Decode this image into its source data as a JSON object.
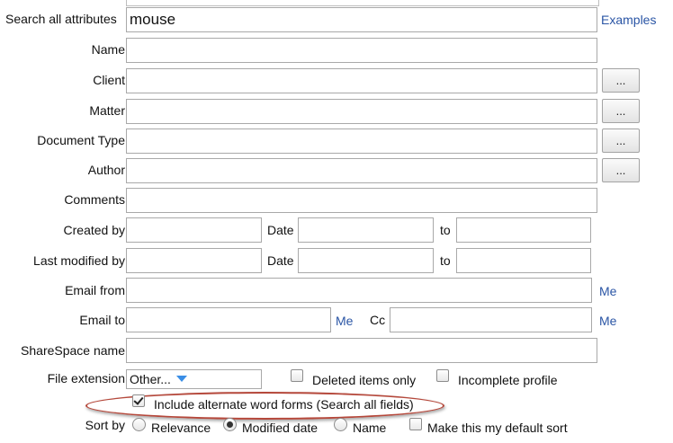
{
  "search_all": {
    "label": "Search all attributes",
    "value": "mouse",
    "examples_link": "Examples"
  },
  "name": {
    "label": "Name",
    "value": ""
  },
  "client": {
    "label": "Client",
    "value": "",
    "browse": "..."
  },
  "matter": {
    "label": "Matter",
    "value": "",
    "browse": "..."
  },
  "document_type": {
    "label": "Document Type",
    "value": "",
    "browse": "..."
  },
  "author": {
    "label": "Author",
    "value": "",
    "browse": "..."
  },
  "comments": {
    "label": "Comments",
    "value": ""
  },
  "created": {
    "label": "Created by",
    "value": "",
    "date_label": "Date",
    "date_from": "",
    "to_label": "to",
    "date_to": ""
  },
  "modified": {
    "label": "Last modified by",
    "value": "",
    "date_label": "Date",
    "date_from": "",
    "to_label": "to",
    "date_to": ""
  },
  "email_from": {
    "label": "Email from",
    "value": "",
    "me_link": "Me"
  },
  "email_to": {
    "label": "Email to",
    "value": "",
    "me_link": "Me",
    "cc_label": "Cc",
    "cc_value": "",
    "cc_me_link": "Me"
  },
  "sharespace": {
    "label": "ShareSpace name",
    "value": ""
  },
  "file_extension": {
    "label": "File extension",
    "selected": "Other..."
  },
  "deleted_items": {
    "label": "Deleted items only",
    "checked": false
  },
  "incomplete_profile": {
    "label": "Incomplete profile",
    "checked": false
  },
  "alternate_forms": {
    "label": "Include alternate word forms (Search all fields)",
    "checked": true
  },
  "sort": {
    "label": "Sort by",
    "options": [
      "Relevance",
      "Modified date",
      "Name"
    ],
    "selected": "Modified date",
    "default_label": "Make this my default sort",
    "default_checked": false
  },
  "colors": {
    "link": "#2a55a5",
    "highlight_oval": "#b5483b",
    "dropdown_caret": "#3a8ee6"
  }
}
